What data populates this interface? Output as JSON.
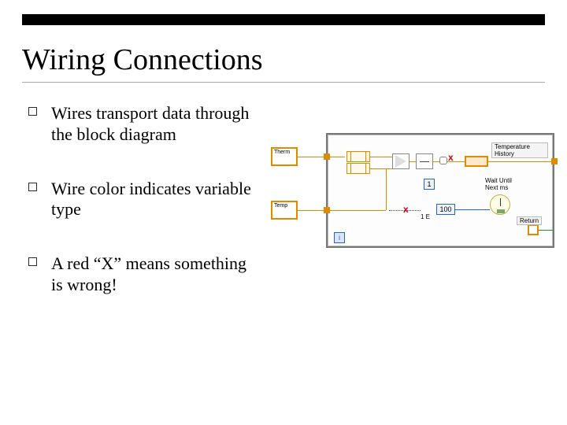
{
  "slide": {
    "title": "Wiring Connections",
    "bullets": [
      "Wires transport data through the block diagram",
      "Wire color indicates variable type",
      "A red “X” means something is wrong!"
    ]
  },
  "diagram": {
    "terminal_left_1": "Therm",
    "terminal_left_2": "Temp",
    "iteration_terminal": "i",
    "const_1": "1",
    "const_100": "100",
    "wait_label_line1": "Wait Until",
    "wait_label_line2": "Next ms",
    "right_label_top": "Temperature History",
    "right_label_bottom": "Return",
    "red_x": "x",
    "error_count_label": "1 E"
  }
}
